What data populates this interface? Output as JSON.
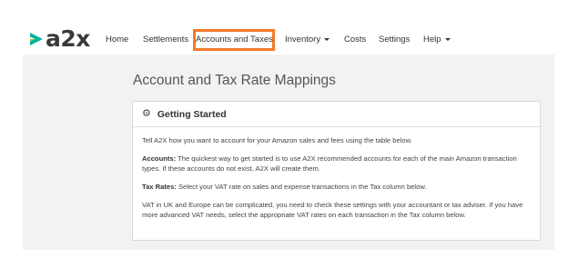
{
  "brand": {
    "logo_text": "a2x",
    "logo_colors": [
      "#00b3a0",
      "#8dc63f"
    ]
  },
  "nav": {
    "items": [
      {
        "label": "Home",
        "dropdown": false,
        "active": false
      },
      {
        "label": "Settlements",
        "dropdown": false,
        "active": false
      },
      {
        "label": "Accounts and Taxes",
        "dropdown": false,
        "active": true
      },
      {
        "label": "Inventory",
        "dropdown": true,
        "active": false
      },
      {
        "label": "Costs",
        "dropdown": false,
        "active": false
      },
      {
        "label": "Settings",
        "dropdown": false,
        "active": false
      },
      {
        "label": "Help",
        "dropdown": true,
        "active": false
      }
    ],
    "highlight_color": "#f47a2a"
  },
  "page": {
    "title": "Account and Tax Rate Mappings"
  },
  "panel": {
    "icon": "gear-icon",
    "title": "Getting Started",
    "intro": "Tell A2X how you want to account for your Amazon sales and fees using the table below.",
    "accounts_label": "Accounts:",
    "accounts_text": " The quickest way to get started is to use A2X recommended accounts for each of the main Amazon transaction types. If these accounts do not exist, A2X will create them.",
    "tax_label": "Tax Rates:",
    "tax_text": " Select your VAT rate on sales and expense transactions in the Tax column below.",
    "vat_text": "VAT in UK and Europe can be complicated, you need to check these settings with your accountant or tax adviser. If you have more advanced VAT needs, select the appropriate VAT rates on each transaction in the Tax column below."
  }
}
